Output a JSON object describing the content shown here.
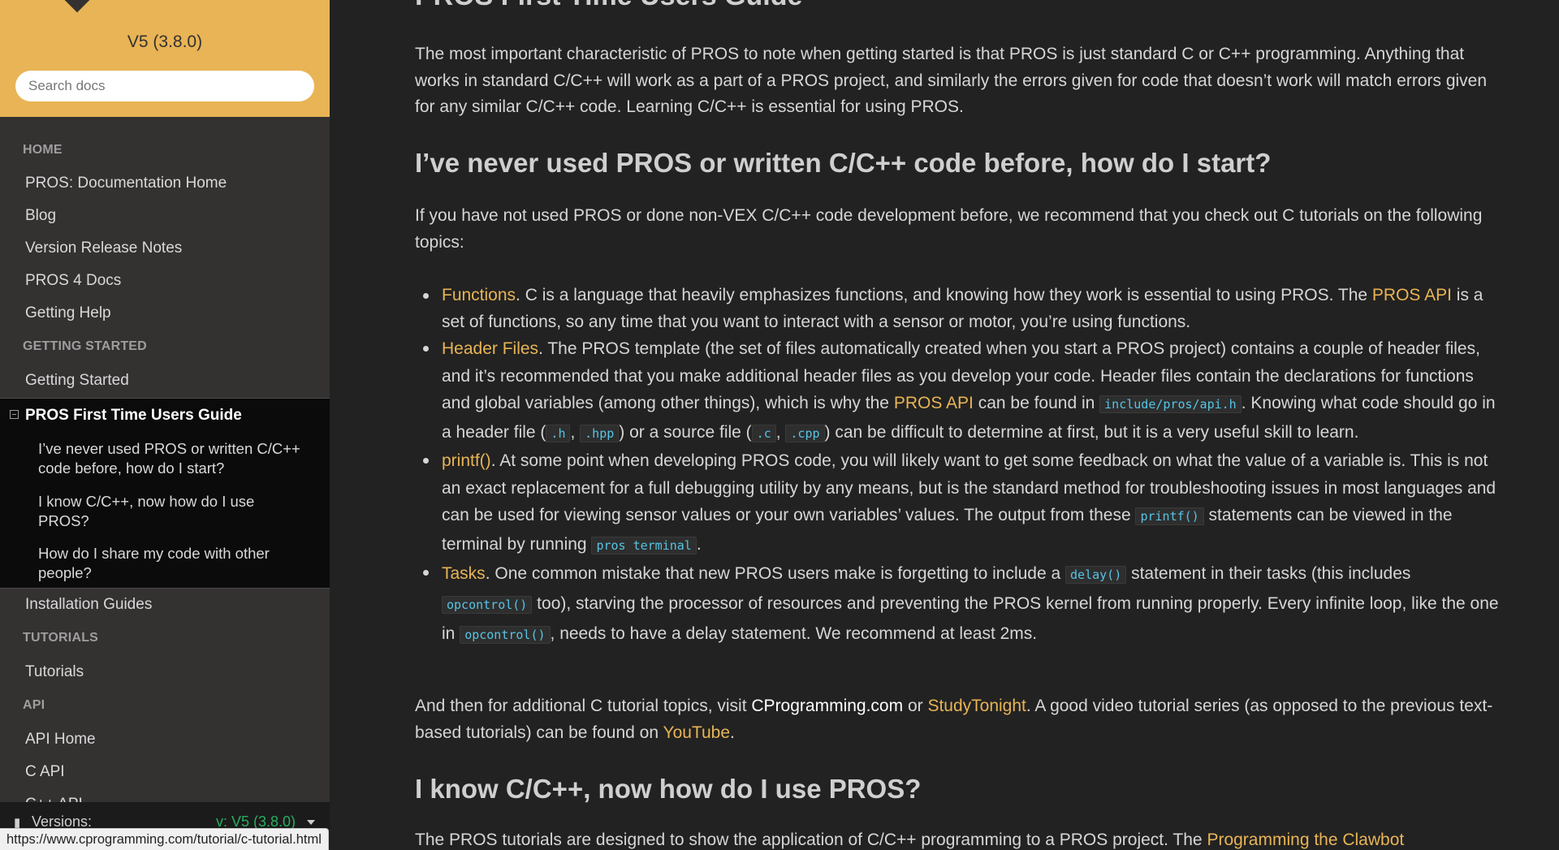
{
  "sidebar": {
    "version": "V5 (3.8.0)",
    "search_placeholder": "Search docs",
    "captions": [
      "HOME",
      "GETTING STARTED",
      "TUTORIALS",
      "API"
    ],
    "home_links": [
      "PROS: Documentation Home",
      "Blog",
      "Version Release Notes",
      "PROS 4 Docs",
      "Getting Help"
    ],
    "getting_started_link": "Getting Started",
    "current": {
      "title": "PROS First Time Users Guide",
      "subsections": [
        "I’ve never used PROS or written C/C++ code before, how do I start?",
        "I know C/C++, now how do I use PROS?",
        "How do I share my code with other people?"
      ]
    },
    "installation_link": "Installation Guides",
    "tutorials_link": "Tutorials",
    "api_links": [
      "API Home",
      "C API",
      "C++ API"
    ],
    "versions": {
      "label": "Versions:",
      "current": "v: V5 (3.8.0)"
    }
  },
  "content": {
    "page_title": "PROS First Time Users Guide",
    "intro": "The most important characteristic of PROS to note when getting started is that PROS is just standard C or C++ programming. Anything that works in standard C/C++ will work as a part of a PROS project, and similarly the errors given for code that doesn’t work will match errors given for any similar C/C++ code. Learning C/C++ is essential for using PROS.",
    "section1_heading": "I’ve never used PROS or written C/C++ code before, how do I start?",
    "section1_intro": "If you have not used PROS or done non-VEX C/C++ code development before, we recommend that you check out C tutorials on the following topics:",
    "bullets": {
      "functions": {
        "link": "Functions",
        "text1": ". C is a language that heavily emphasizes functions, and knowing how they work is essential to using PROS. The ",
        "link2": "PROS API",
        "text2": " is a set of functions, so any time that you want to interact with a sensor or motor, you’re using functions."
      },
      "headers": {
        "link": "Header Files",
        "text1": ". The PROS template (the set of files automatically created when you start a PROS project) contains a couple of header files, and it’s recommended that you make additional header files as you develop your code. Header files contain the declarations for functions and global variables (among other things), which is why the ",
        "link2": "PROS API",
        "text2": " can be found in ",
        "code1": "include/pros/api.h",
        "text3": ". Knowing what code should go in a header file (",
        "code2": ".h",
        "sep1": ", ",
        "code3": ".hpp",
        "text4": ") or a source file (",
        "code4": ".c",
        "sep2": ", ",
        "code5": ".cpp",
        "text5": ") can be difficult to determine at first, but it is a very useful skill to learn."
      },
      "printf": {
        "link": "printf()",
        "text1": ". At some point when developing PROS code, you will likely want to get some feedback on what the value of a variable is. This is not an exact replacement for a full debugging utility by any means, but is the standard method for troubleshooting issues in most languages and can be used for viewing sensor values or your own variables’ values. The output from these ",
        "code1": "printf()",
        "text2": " statements can be viewed in the terminal by running ",
        "code2": "pros terminal",
        "text3": "."
      },
      "tasks": {
        "link": "Tasks",
        "text1": ". One common mistake that new PROS users make is forgetting to include a ",
        "code1": "delay()",
        "text2": " statement in their tasks (this includes ",
        "code2": "opcontrol()",
        "text3": " too), starving the processor of resources and preventing the PROS kernel from running properly. Every infinite loop, like the one in ",
        "code3": "opcontrol()",
        "text4": ", needs to have a delay statement. We recommend at least 2ms."
      }
    },
    "additional": {
      "text1": "And then for additional C tutorial topics, visit ",
      "link1": "CProgramming.com",
      "text2": " or ",
      "link2": "StudyTonight",
      "text3": ". A good video tutorial series (as opposed to the previous text-based tutorials) can be found on ",
      "link3": "YouTube",
      "text4": "."
    },
    "section2_heading": "I know C/C++, now how do I use PROS?",
    "section2_text": "The PROS tutorials are designed to show the application of C/C++ programming to a PROS project. The ",
    "section2_link": "Programming the Clawbot"
  },
  "status_url": "https://www.cprogramming.com/tutorial/c-tutorial.html",
  "colors": {
    "accent": "#e8b455",
    "sidebar": "#343131",
    "background": "#222222",
    "code": "#56c4e4",
    "versions": "#27ae60"
  }
}
